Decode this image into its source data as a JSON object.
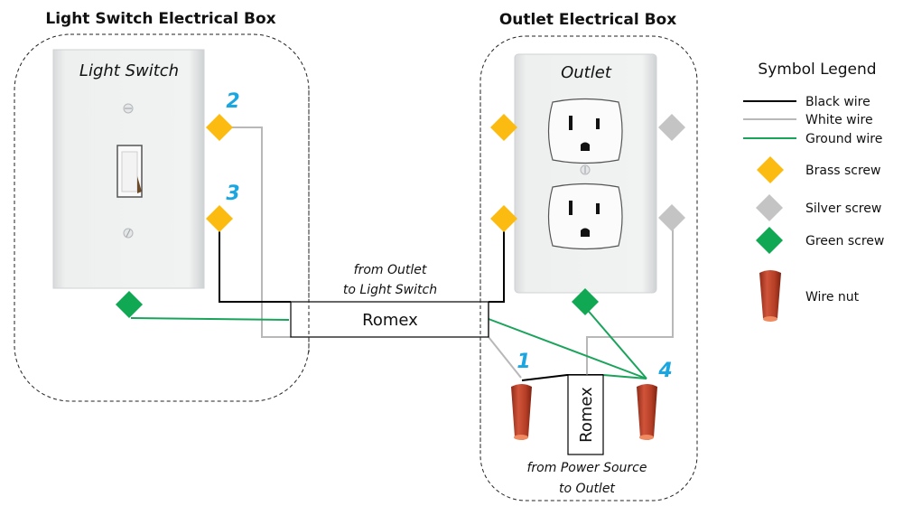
{
  "titles": {
    "switch_box": "Light Switch Electrical Box",
    "outlet_box": "Outlet Electrical Box"
  },
  "devices": {
    "switch_label": "Light Switch",
    "outlet_label": "Outlet"
  },
  "cables": {
    "romex_top_label": "Romex",
    "romex_top_note_line1": "from Outlet",
    "romex_top_note_line2": "to Light Switch",
    "romex_bottom_label": "Romex",
    "romex_bottom_note_line1": "from Power Source",
    "romex_bottom_note_line2": "to Outlet"
  },
  "step_numbers": [
    "1",
    "2",
    "3",
    "4"
  ],
  "legend": {
    "title": "Symbol Legend",
    "items": [
      {
        "label": "Black wire",
        "symbol": "line",
        "color": "#000000"
      },
      {
        "label": "White wire",
        "symbol": "line",
        "color": "#b8b8b8"
      },
      {
        "label": "Ground wire",
        "symbol": "line",
        "color": "#1aa35a"
      },
      {
        "label": "Brass screw",
        "symbol": "diamond",
        "color": "#fbbb10"
      },
      {
        "label": "Silver screw",
        "symbol": "diamond",
        "color": "#c4c4c4"
      },
      {
        "label": "Green screw",
        "symbol": "diamond",
        "color": "#10a853"
      },
      {
        "label": "Wire nut",
        "symbol": "wire-nut",
        "color": "#c0402a"
      }
    ]
  },
  "colors": {
    "black_wire": "#000000",
    "white_wire": "#b8b8b8",
    "ground_wire": "#1aa35a",
    "brass_screw": "#fbbb10",
    "silver_screw": "#c4c4c4",
    "green_screw": "#10a853",
    "wire_nut": "#c0402a",
    "step_number": "#1aa6e0"
  }
}
